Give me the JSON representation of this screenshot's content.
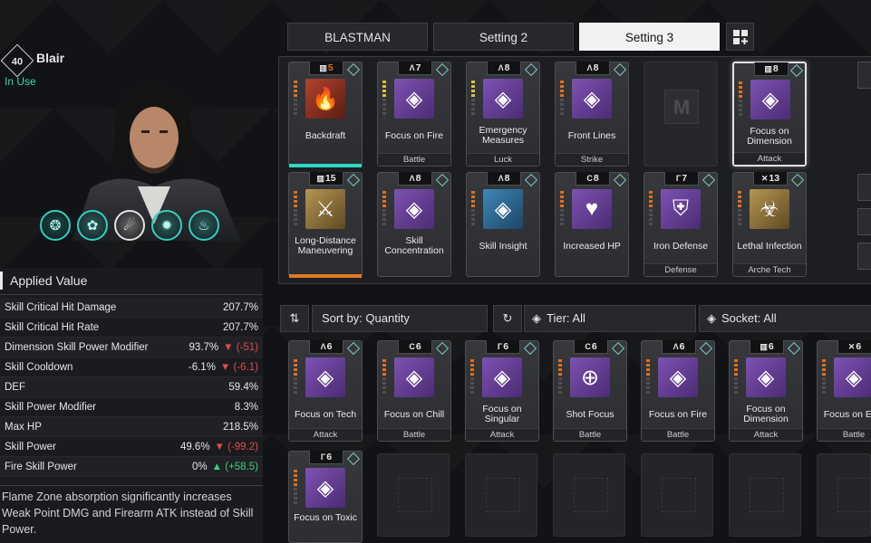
{
  "character": {
    "level": "40",
    "name": "Blair",
    "status": "In Use",
    "skill_icons": [
      "flame-ring-icon",
      "leaf-flame-icon",
      "meteor-icon",
      "gear-flame-icon",
      "fire-orb-icon"
    ]
  },
  "applied_value": {
    "title": "Applied Value",
    "stats": [
      {
        "name": "Skill Critical Hit Damage",
        "value": "207.7%",
        "delta": "",
        "dir": ""
      },
      {
        "name": "Skill Critical Hit Rate",
        "value": "207.7%",
        "delta": "",
        "dir": ""
      },
      {
        "name": "Dimension Skill Power Modifier",
        "value": "93.7%",
        "delta": "(-51)",
        "dir": "down"
      },
      {
        "name": "Skill Cooldown",
        "value": "-6.1%",
        "delta": "(-6.1)",
        "dir": "down"
      },
      {
        "name": "DEF",
        "value": "59.4%",
        "delta": "",
        "dir": ""
      },
      {
        "name": "Skill Power Modifier",
        "value": "8.3%",
        "delta": "",
        "dir": ""
      },
      {
        "name": "Max HP",
        "value": "218.5%",
        "delta": "",
        "dir": ""
      },
      {
        "name": "Skill Power",
        "value": "49.6%",
        "delta": "(-99.2)",
        "dir": "down"
      },
      {
        "name": "Fire Skill Power",
        "value": "0%",
        "delta": "(+58.5)",
        "dir": "up"
      }
    ],
    "description": "Flame Zone absorption significantly increases Weak Point DMG and Firearm ATK instead of Skill Power."
  },
  "tabs": [
    {
      "label": "BLASTMAN",
      "active": false
    },
    {
      "label": "Setting 2",
      "active": false
    },
    {
      "label": "Setting 3",
      "active": true
    }
  ],
  "equipped": [
    {
      "name": "Backdraft",
      "cost": "5",
      "sym": "▥",
      "icon": "red",
      "glyph": "🔥",
      "type": "",
      "bars": "orange",
      "glow": "teal",
      "capColor": "#e0701c"
    },
    {
      "name": "Focus on Fire",
      "cost": "7",
      "sym": "Λ",
      "icon": "purple",
      "glyph": "◈",
      "type": "Battle",
      "bars": "yellow"
    },
    {
      "name": "Emergency Measures",
      "cost": "8",
      "sym": "Λ",
      "icon": "purple",
      "glyph": "◈",
      "type": "Luck",
      "bars": "yellow"
    },
    {
      "name": "Front Lines",
      "cost": "8",
      "sym": "Λ",
      "icon": "purple",
      "glyph": "◈",
      "type": "Strike",
      "bars": "orange"
    },
    {
      "empty": true
    },
    {
      "name": "Focus on Dimension",
      "cost": "8",
      "sym": "▥",
      "icon": "purple",
      "glyph": "◈",
      "type": "Attack",
      "bars": "orange",
      "selected": true
    },
    {
      "name": "Long-Distance Maneuvering",
      "cost": "15",
      "sym": "▥",
      "icon": "gold",
      "glyph": "⚔",
      "type": "",
      "bars": "orange",
      "glow": "orange"
    },
    {
      "name": "Skill Concentration",
      "cost": "8",
      "sym": "Λ",
      "icon": "purple",
      "glyph": "◈",
      "type": "",
      "bars": "orange"
    },
    {
      "name": "Skill Insight",
      "cost": "8",
      "sym": "Λ",
      "icon": "blue",
      "glyph": "◈",
      "type": "",
      "bars": "orange"
    },
    {
      "name": "Increased HP",
      "cost": "8",
      "sym": "C",
      "icon": "purple",
      "glyph": "♥",
      "type": "",
      "bars": "orange"
    },
    {
      "name": "Iron Defense",
      "cost": "7",
      "sym": "Γ",
      "icon": "purple",
      "glyph": "⛨",
      "type": "Defense",
      "bars": "orange"
    },
    {
      "name": "Lethal Infection",
      "cost": "13",
      "sym": "✕",
      "icon": "gold",
      "glyph": "☣",
      "type": "Arche Tech",
      "bars": "orange"
    }
  ],
  "filters": {
    "sort_label": "Sort by: Quantity",
    "tier_label": "Tier: All",
    "socket_label": "Socket: All"
  },
  "inventory": [
    {
      "name": "Focus on Tech",
      "cost": "6",
      "sym": "Λ",
      "icon": "purple",
      "glyph": "◈",
      "type": "Attack",
      "bars": "orange"
    },
    {
      "name": "Focus on Chill",
      "cost": "6",
      "sym": "C",
      "icon": "purple",
      "glyph": "◈",
      "type": "Battle",
      "bars": "orange"
    },
    {
      "name": "Focus on Singular",
      "cost": "6",
      "sym": "Γ",
      "icon": "purple",
      "glyph": "◈",
      "type": "Attack",
      "bars": "orange"
    },
    {
      "name": "Shot Focus",
      "cost": "6",
      "sym": "C",
      "icon": "purple",
      "glyph": "⊕",
      "type": "Battle",
      "bars": "orange"
    },
    {
      "name": "Focus on Fire",
      "cost": "6",
      "sym": "Λ",
      "icon": "purple",
      "glyph": "◈",
      "type": "Battle",
      "bars": "orange"
    },
    {
      "name": "Focus on Dimension",
      "cost": "6",
      "sym": "▥",
      "icon": "purple",
      "glyph": "◈",
      "type": "Attack",
      "bars": "orange"
    },
    {
      "name": "Focus on Elec",
      "cost": "6",
      "sym": "✕",
      "icon": "purple",
      "glyph": "◈",
      "type": "Battle",
      "bars": "orange"
    },
    {
      "name": "Focus on Toxic",
      "cost": "6",
      "sym": "Γ",
      "icon": "purple",
      "glyph": "◈",
      "type": "",
      "bars": "orange"
    }
  ]
}
